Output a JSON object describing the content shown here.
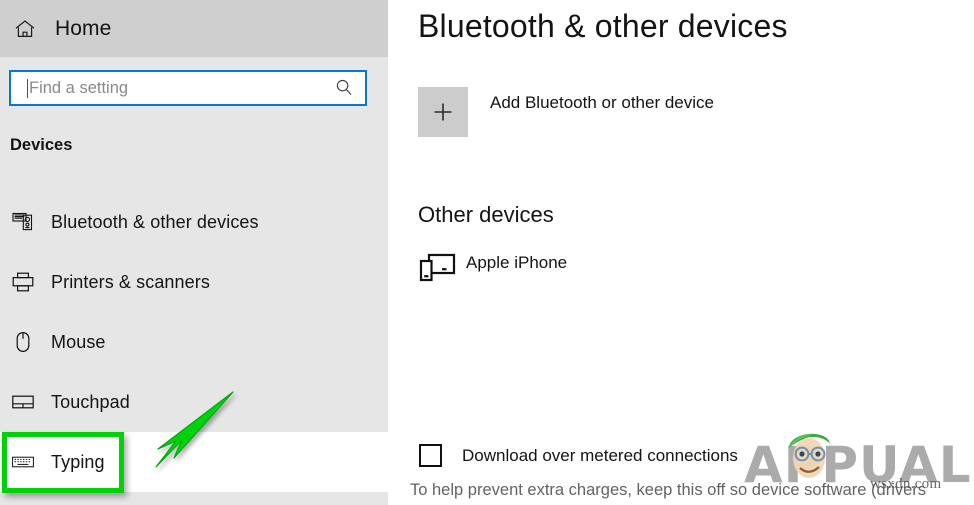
{
  "sidebar": {
    "home": {
      "label": "Home",
      "icon": "home-icon"
    },
    "search": {
      "value": "",
      "placeholder": "Find a setting",
      "icon": "search-icon"
    },
    "group_title": "Devices",
    "items": [
      {
        "label": "Bluetooth & other devices",
        "icon": "bluetooth-device-icon",
        "selected": false
      },
      {
        "label": "Printers & scanners",
        "icon": "printer-icon",
        "selected": false
      },
      {
        "label": "Mouse",
        "icon": "mouse-icon",
        "selected": false
      },
      {
        "label": "Touchpad",
        "icon": "touchpad-icon",
        "selected": false
      },
      {
        "label": "Typing",
        "icon": "keyboard-icon",
        "selected": true
      }
    ]
  },
  "main": {
    "title": "Bluetooth & other devices",
    "add_device": {
      "label": "Add Bluetooth or other device",
      "icon": "plus-icon"
    },
    "other_devices": {
      "heading": "Other devices",
      "devices": [
        {
          "label": "Apple iPhone",
          "icon": "phone-and-tablet-icon"
        }
      ]
    },
    "metered": {
      "checkbox_label": "Download over metered connections",
      "checked": false,
      "helper_text": "To help prevent extra charges, keep this off so device software (drivers"
    }
  },
  "annotation": {
    "highlight_target": "Typing",
    "highlight_color": "#00d20a",
    "arrow_color": "#00d20a"
  },
  "watermark": {
    "brand": "APPUALS",
    "url": "wsxdn.com"
  },
  "colors": {
    "accent": "#0078d7",
    "sidebar_bg": "#e6e6e6",
    "sidebar_header_bg": "#cfcfcf",
    "content_bg": "#ffffff",
    "tile_bg": "#cccccc"
  }
}
